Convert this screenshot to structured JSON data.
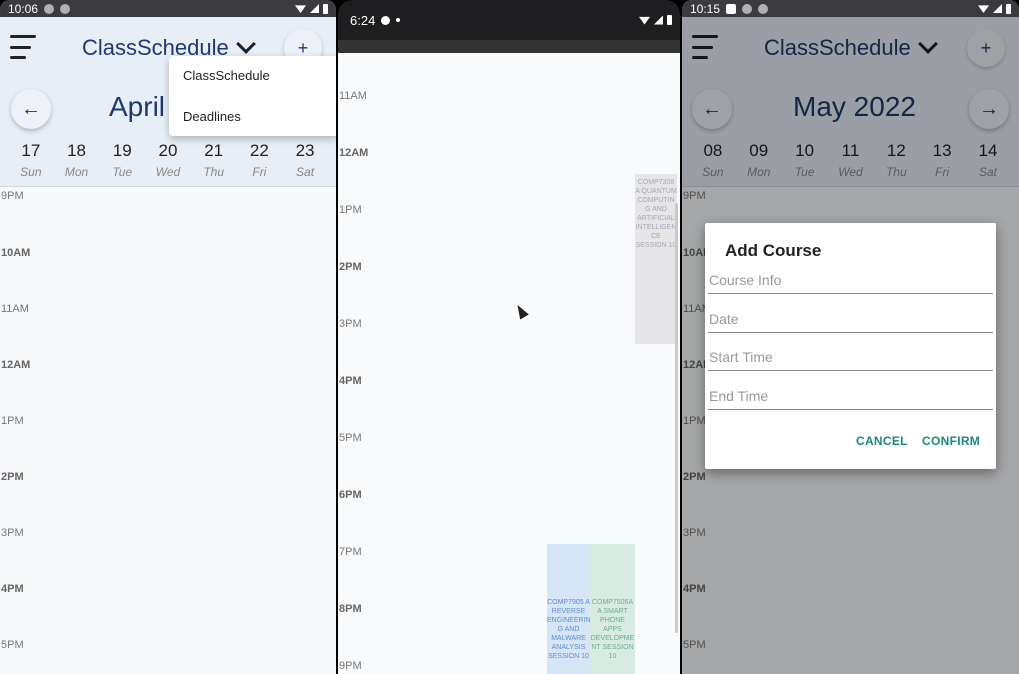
{
  "screen1": {
    "status_time": "10:06",
    "app_title": "ClassSchedule",
    "month_title": "April",
    "prev_arrow": "←",
    "plus": "+",
    "dropdown": [
      "ClassSchedule",
      "Deadlines"
    ],
    "days": [
      {
        "num": "17",
        "name": "Sun"
      },
      {
        "num": "18",
        "name": "Mon"
      },
      {
        "num": "19",
        "name": "Tue"
      },
      {
        "num": "20",
        "name": "Wed"
      },
      {
        "num": "21",
        "name": "Thu"
      },
      {
        "num": "22",
        "name": "Fri"
      },
      {
        "num": "23",
        "name": "Sat"
      }
    ],
    "times": [
      "9PM",
      "10AM",
      "11AM",
      "12AM",
      "1PM",
      "2PM",
      "3PM",
      "4PM",
      "5PM"
    ]
  },
  "screen2": {
    "status_time": "6:24",
    "times": [
      "11AM",
      "12AM",
      "1PM",
      "2PM",
      "3PM",
      "4PM",
      "5PM",
      "6PM",
      "7PM",
      "8PM",
      "9PM"
    ],
    "events": [
      {
        "text": "COMP7308 A QUANTUM COMPUTIN G AND ARTIFICIAL INTELLIGEN CE SESSION 10",
        "color": "#e6e6e9",
        "text_color": "#a6a6b3"
      },
      {
        "text": "COMP7905 A REVERSE ENGINEERIN G AND MALWARE ANALYSIS SESSION 10",
        "color": "#d7e6f6",
        "text_color": "#5d8fd2"
      },
      {
        "text": "COMP7506A A SMART PHONE APPS DEVELOPME NT SESSION 10",
        "color": "#d8ebe3",
        "text_color": "#6cae8d"
      }
    ]
  },
  "screen3": {
    "status_time": "10:15",
    "app_title": "ClassSchedule",
    "month_title": "May 2022",
    "prev_arrow": "←",
    "next_arrow": "→",
    "plus": "+",
    "days": [
      {
        "num": "08",
        "name": "Sun"
      },
      {
        "num": "09",
        "name": "Mon"
      },
      {
        "num": "10",
        "name": "Tue"
      },
      {
        "num": "11",
        "name": "Wed"
      },
      {
        "num": "12",
        "name": "Thu"
      },
      {
        "num": "13",
        "name": "Fri"
      },
      {
        "num": "14",
        "name": "Sat"
      }
    ],
    "times": [
      "9PM",
      "10AM",
      "11AM",
      "12AM",
      "1PM",
      "2PM",
      "3PM",
      "4PM",
      "5PM"
    ],
    "dialog": {
      "title": "Add Course",
      "course_info_placeholder": "Course Info",
      "date_placeholder": "Date",
      "start_time_placeholder": "Start Time",
      "end_time_placeholder": "End Time",
      "cancel": "CANCEL",
      "confirm": "CONFIRM"
    }
  }
}
